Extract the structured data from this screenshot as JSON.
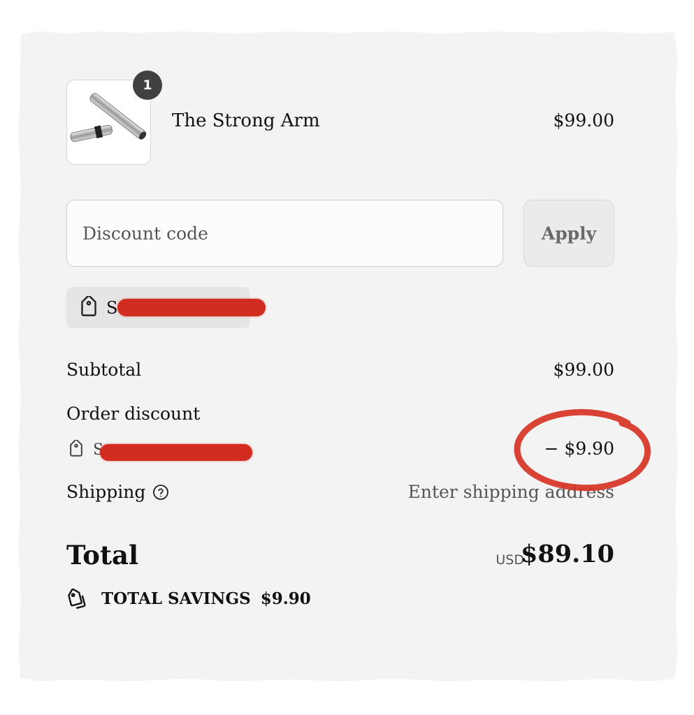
{
  "cart": {
    "item": {
      "name": "The Strong Arm",
      "price": "$99.00",
      "quantity": "1",
      "thumbnail_icon": "chrome-bar-product-image"
    }
  },
  "discount": {
    "placeholder": "Discount code",
    "apply_label": "Apply",
    "applied_code_visible": "S",
    "applied_code_icon": "tag-icon"
  },
  "summary": {
    "subtotal_label": "Subtotal",
    "subtotal_value": "$99.00",
    "order_discount_label": "Order discount",
    "discount_code_visible": "S",
    "discount_value": "− $9.90",
    "shipping_label": "Shipping",
    "shipping_value": "Enter shipping address",
    "total_label": "Total",
    "currency": "USD",
    "total_value": "$89.10",
    "savings_label": "TOTAL SAVINGS",
    "savings_value": "$9.90"
  },
  "colors": {
    "redaction": "#d22b20",
    "annotation_circle": "#d63426",
    "badge": "#404040"
  }
}
